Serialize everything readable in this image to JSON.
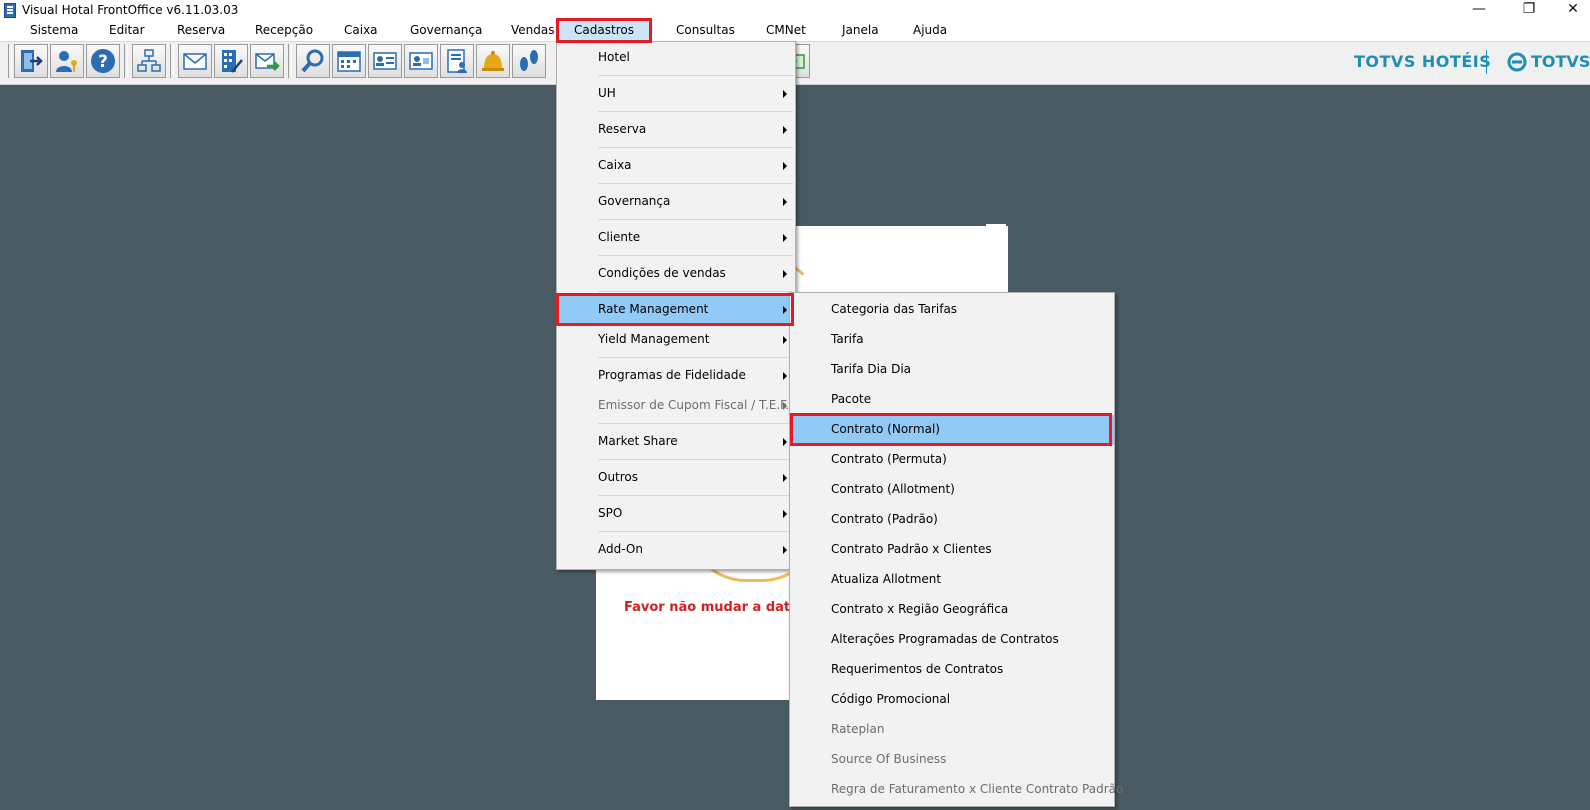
{
  "window": {
    "title": "Visual Hotal FrontOffice v6.11.03.03",
    "minimize_glyph": "—",
    "maximize_glyph": "❐",
    "close_glyph": "✕"
  },
  "menubar": {
    "items": [
      "Sistema",
      "Editar",
      "Reserva",
      "Recepção",
      "Caixa",
      "Governança",
      "Vendas",
      "Cadastros",
      "Consultas",
      "CMNet",
      "Janela",
      "Ajuda"
    ],
    "active": "Cadastros"
  },
  "toolbar": {
    "icons": [
      "exit-door-icon",
      "user-key-icon",
      "help-icon",
      "org-chart-icon",
      "mail-icon",
      "building-edit-icon",
      "mail-forward-icon",
      "search-icon",
      "calendar-icon",
      "id-card-icon",
      "guest-card-icon",
      "document-user-icon",
      "bell-icon",
      "footprints-icon"
    ]
  },
  "logos": {
    "brand_left": "TOTVS HOTÉIS",
    "brand_right": "TOTVS"
  },
  "background_card": {
    "warning_text": "Favor não mudar a data da I"
  },
  "cadastros_menu": {
    "items": [
      {
        "label": "Hotel",
        "submenu": false,
        "enabled": true
      },
      {
        "label": "UH",
        "submenu": true,
        "enabled": true
      },
      {
        "label": "Reserva",
        "submenu": true,
        "enabled": true
      },
      {
        "label": "Caixa",
        "submenu": true,
        "enabled": true
      },
      {
        "label": "Governança",
        "submenu": true,
        "enabled": true
      },
      {
        "label": "Cliente",
        "submenu": true,
        "enabled": true
      },
      {
        "label": "Condições de vendas",
        "submenu": true,
        "enabled": true
      },
      {
        "label": "Rate Management",
        "submenu": true,
        "enabled": true,
        "highlighted": true
      },
      {
        "label": "Yield Management",
        "submenu": true,
        "enabled": true
      },
      {
        "label": "Programas de Fidelidade",
        "submenu": true,
        "enabled": true
      },
      {
        "label": "Emissor de Cupom Fiscal / T.E.F.",
        "submenu": true,
        "enabled": false
      },
      {
        "label": "Market Share",
        "submenu": true,
        "enabled": true
      },
      {
        "label": "Outros",
        "submenu": true,
        "enabled": true
      },
      {
        "label": "SPO",
        "submenu": true,
        "enabled": true
      },
      {
        "label": "Add-On",
        "submenu": true,
        "enabled": true
      }
    ]
  },
  "rate_management_menu": {
    "items": [
      {
        "label": "Categoria das Tarifas",
        "enabled": true
      },
      {
        "label": "Tarifa",
        "enabled": true
      },
      {
        "label": "Tarifa Dia Dia",
        "enabled": true
      },
      {
        "label": "Pacote",
        "enabled": true
      },
      {
        "label": "Contrato (Normal)",
        "enabled": true,
        "highlighted": true
      },
      {
        "label": "Contrato (Permuta)",
        "enabled": true
      },
      {
        "label": "Contrato (Allotment)",
        "enabled": true
      },
      {
        "label": "Contrato (Padrão)",
        "enabled": true
      },
      {
        "label": "Contrato Padrão x Clientes",
        "enabled": true
      },
      {
        "label": "Atualiza Allotment",
        "enabled": true
      },
      {
        "label": "Contrato x Região Geográfica",
        "enabled": true
      },
      {
        "label": "Alterações Programadas de Contratos",
        "enabled": true
      },
      {
        "label": "Requerimentos de Contratos",
        "enabled": true
      },
      {
        "label": "Código Promocional",
        "enabled": true
      },
      {
        "label": "Rateplan",
        "enabled": false
      },
      {
        "label": "Source Of Business",
        "enabled": false
      },
      {
        "label": "Regra de Faturamento x Cliente Contrato Padrão",
        "enabled": false
      }
    ]
  },
  "colors": {
    "workspace_bg": "#4a5a62",
    "highlight": "#91c9f7",
    "annotation_red": "#e41b23",
    "brand_blue": "#1c8fb4"
  }
}
